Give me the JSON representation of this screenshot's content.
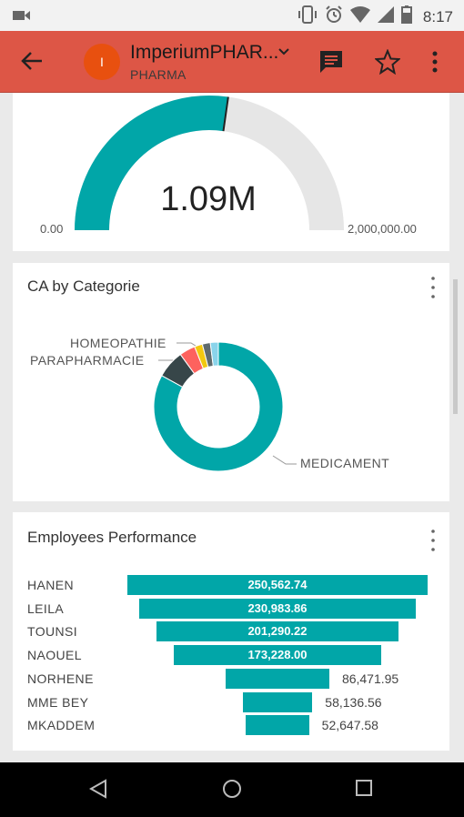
{
  "status_bar": {
    "time": "8:17"
  },
  "app_bar": {
    "avatar_letter": "I",
    "title": "ImperiumPHAR...",
    "subtitle": "PHARMA"
  },
  "gauge_card": {
    "value": "1.09M",
    "min_label": "0.00",
    "max_label": "2,000,000.00",
    "fill_fraction": 0.545,
    "fill_color": "#01a6a8",
    "track_color": "#e6e6e6"
  },
  "donut_card": {
    "title": "CA by Categorie",
    "labels": {
      "homeopathie": "HOMEOPATHIE",
      "parapharmacie": "PARAPHARMACIE",
      "medicament": "MEDICAMENT"
    }
  },
  "perf_card": {
    "title": "Employees Performance"
  },
  "chart_data": [
    {
      "type": "pie",
      "title": "CA by Categorie",
      "donut": true,
      "slices": [
        {
          "label": "MEDICAMENT",
          "value": 0.83,
          "color": "#01a6a8"
        },
        {
          "label": "",
          "value": 0.07,
          "color": "#374649"
        },
        {
          "label": "PARAPHARMACIE",
          "value": 0.04,
          "color": "#fd625e"
        },
        {
          "label": "HOMEOPATHIE",
          "value": 0.02,
          "color": "#f2c80f"
        },
        {
          "label": "",
          "value": 0.02,
          "color": "#5f6b6d"
        },
        {
          "label": "",
          "value": 0.02,
          "color": "#8ad4eb"
        }
      ]
    },
    {
      "type": "bar",
      "title": "Employees Performance",
      "orientation": "funnel",
      "categories": [
        "HANEN",
        "LEILA",
        "TOUNSI",
        "NAOUEL",
        "NORHENE",
        "MME BEY",
        "MKADDEM"
      ],
      "values": [
        250562.74,
        230983.86,
        201290.22,
        173228.0,
        86471.95,
        58136.56,
        52647.58
      ],
      "value_labels": [
        "250,562.74",
        "230,983.86",
        "201,290.22",
        "173,228.00",
        "86,471.95",
        "58,136.56",
        "52,647.58"
      ],
      "color": "#01a6a8"
    }
  ]
}
